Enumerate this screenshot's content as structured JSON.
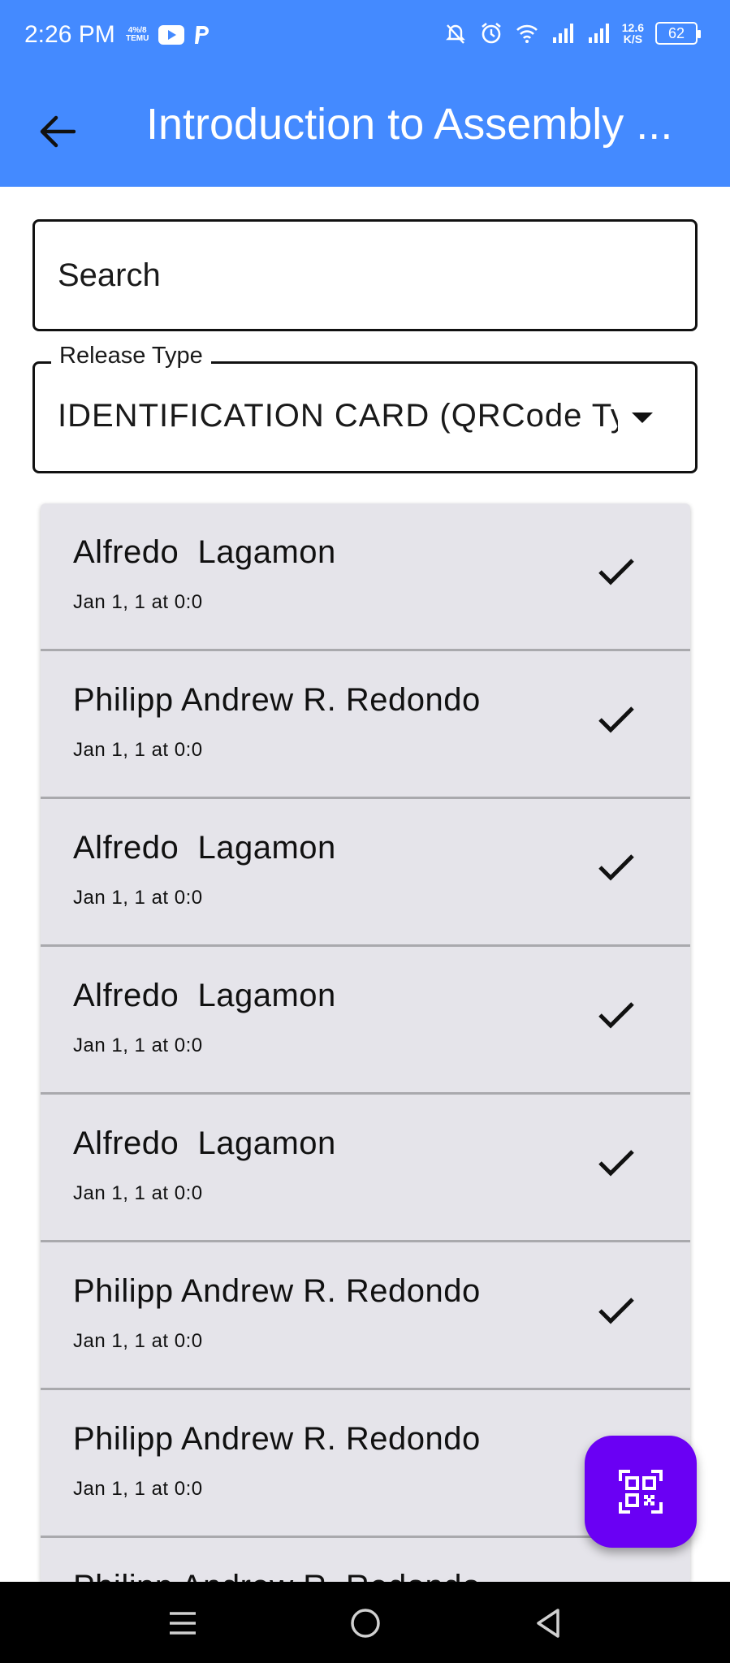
{
  "status_bar": {
    "time": "2:26 PM",
    "left_icons": [
      "data-saver-icon",
      "youtube-icon",
      "paypal-icon"
    ],
    "data_label_top": "4%/8",
    "data_label_bottom": "TEMU",
    "net_speed_value": "12.6",
    "net_speed_unit": "K/S",
    "battery": "62",
    "right_icons": [
      "do-not-disturb-icon",
      "alarm-icon",
      "wifi-icon",
      "signal-icon",
      "signal-icon",
      "battery-icon"
    ]
  },
  "app_bar": {
    "title": "Introduction to Assembly ...",
    "back_icon": "arrow-back-icon",
    "color": "#448aff"
  },
  "search": {
    "placeholder": "Search",
    "value": ""
  },
  "release_type": {
    "label": "Release Type",
    "selected": "IDENTIFICATION CARD (QRCode Type)"
  },
  "list": {
    "items": [
      {
        "name": "Alfredo  Lagamon",
        "date": "Jan 1, 1 at 0:0",
        "checked": true
      },
      {
        "name": "Philipp Andrew R. Redondo",
        "date": "Jan 1, 1 at 0:0",
        "checked": true
      },
      {
        "name": "Alfredo  Lagamon",
        "date": "Jan 1, 1 at 0:0",
        "checked": true
      },
      {
        "name": "Alfredo  Lagamon",
        "date": "Jan 1, 1 at 0:0",
        "checked": true
      },
      {
        "name": "Alfredo  Lagamon",
        "date": "Jan 1, 1 at 0:0",
        "checked": true
      },
      {
        "name": "Philipp Andrew R. Redondo",
        "date": "Jan 1, 1 at 0:0",
        "checked": true
      },
      {
        "name": "Philipp Andrew R. Redondo",
        "date": "Jan 1, 1 at 0:0",
        "checked": false
      },
      {
        "name": "Philipp Andrew R. Redondo",
        "date": "",
        "checked": false
      }
    ]
  },
  "fab": {
    "icon": "qr-code-scanner-icon",
    "color": "#6a00f4"
  },
  "nav_bar": {
    "buttons": [
      "menu-icon",
      "home-icon",
      "back-triangle-icon"
    ]
  }
}
